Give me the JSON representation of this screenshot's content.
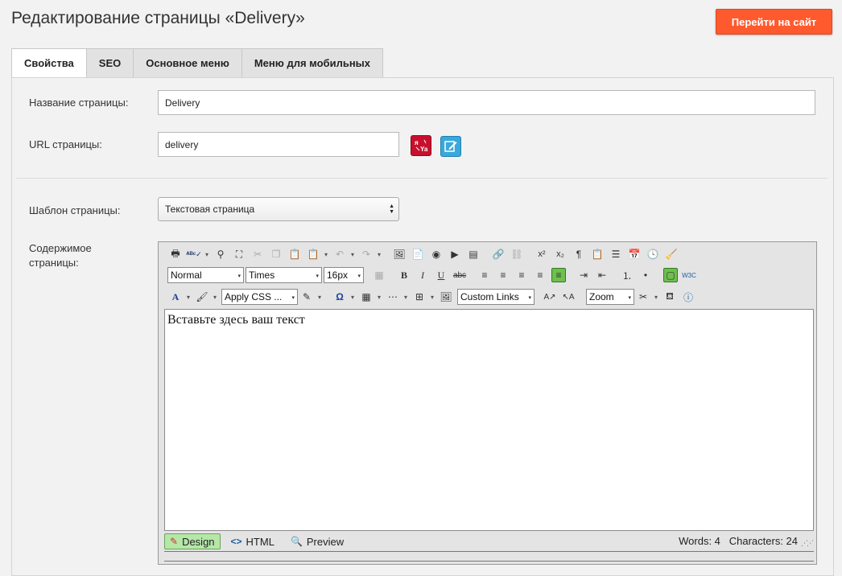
{
  "page": {
    "title": "Редактирование страницы «Delivery»",
    "goto_site_label": "Перейти на сайт"
  },
  "tabs": [
    {
      "label": "Свойства",
      "active": true
    },
    {
      "label": "SEO"
    },
    {
      "label": "Основное меню"
    },
    {
      "label": "Меню для мобильных"
    }
  ],
  "form": {
    "name_label": "Название страницы:",
    "name_value": "Delivery",
    "url_label": "URL страницы:",
    "url_value": "delivery",
    "translit_icon": "translit-icon",
    "edit_url_icon": "edit-icon",
    "template_label": "Шаблон страницы:",
    "template_value": "Текстовая страница",
    "content_label_line1": "Содержимое",
    "content_label_line2": "страницы:"
  },
  "editor": {
    "format_value": "Normal",
    "font_value": "Times",
    "size_value": "16px",
    "css_value": "Apply CSS ...",
    "links_value": "Custom Links",
    "zoom_value": "Zoom",
    "content_text": "Вставьте здесь ваш текст",
    "modes": [
      "Design",
      "HTML",
      "Preview"
    ],
    "stats_text": "Words: 4   Characters: 24",
    "accent_active": "#6fbf4f"
  },
  "colors": {
    "goto_button": "#ff5a2e",
    "background": "#f2f2f2"
  }
}
